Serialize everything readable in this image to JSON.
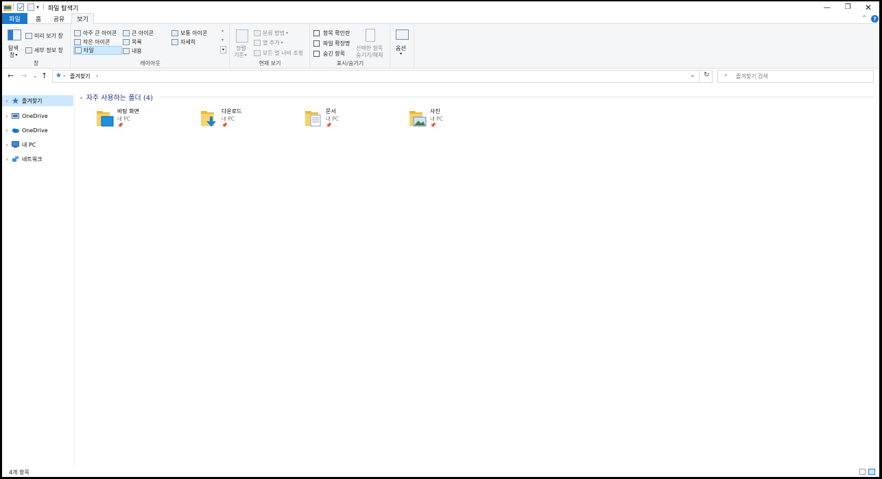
{
  "window": {
    "title": "파일 탐색기"
  },
  "tabs": {
    "file": "파일",
    "home": "홈",
    "share": "공유",
    "view": "보기"
  },
  "ribbon": {
    "pane": {
      "nav_pane_line1": "탐색",
      "nav_pane_line2": "창",
      "preview": "미리 보기 창",
      "details": "세부 정보 창",
      "label": "창"
    },
    "layout": {
      "xlarge": "아주 큰 아이콘",
      "large": "큰 아이콘",
      "medium": "보통 아이콘",
      "small": "작은 아이콘",
      "list": "목록",
      "details": "자세히",
      "tiles": "타일",
      "content": "내용",
      "label": "레이아웃"
    },
    "current_view": {
      "sort_line1": "정렬",
      "sort_line2": "기준",
      "group_by": "분류 방법",
      "add_columns": "열 추가",
      "size_all": "모든 열 너비 조정",
      "label": "현재 보기"
    },
    "show_hide": {
      "item_checkboxes": "항목 확인란",
      "extensions": "파일 확장명",
      "hidden_items": "숨긴 항목",
      "hide_selected_line1": "선택한 항목",
      "hide_selected_line2": "숨기기/해제",
      "label": "표시/숨기기"
    },
    "options": {
      "label": "옵션"
    }
  },
  "address": {
    "path": "즐겨찾기",
    "search_placeholder": "즐겨찾기 검색"
  },
  "nav": {
    "items": [
      {
        "label": "즐겨찾기"
      },
      {
        "label": "OneDrive"
      },
      {
        "label": "OneDrive"
      },
      {
        "label": "내 PC"
      },
      {
        "label": "네트워크"
      }
    ]
  },
  "content": {
    "group_title": "자주 사용하는 폴더 (4)",
    "folders": [
      {
        "name": "바탕 화면",
        "location": "내 PC"
      },
      {
        "name": "다운로드",
        "location": "내 PC"
      },
      {
        "name": "문서",
        "location": "내 PC"
      },
      {
        "name": "사진",
        "location": "내 PC"
      }
    ]
  },
  "status": {
    "item_count": "4개 항목"
  },
  "colors": {
    "accent": "#1979ca",
    "selection": "#cce8ff",
    "group_header": "#1e3287"
  }
}
